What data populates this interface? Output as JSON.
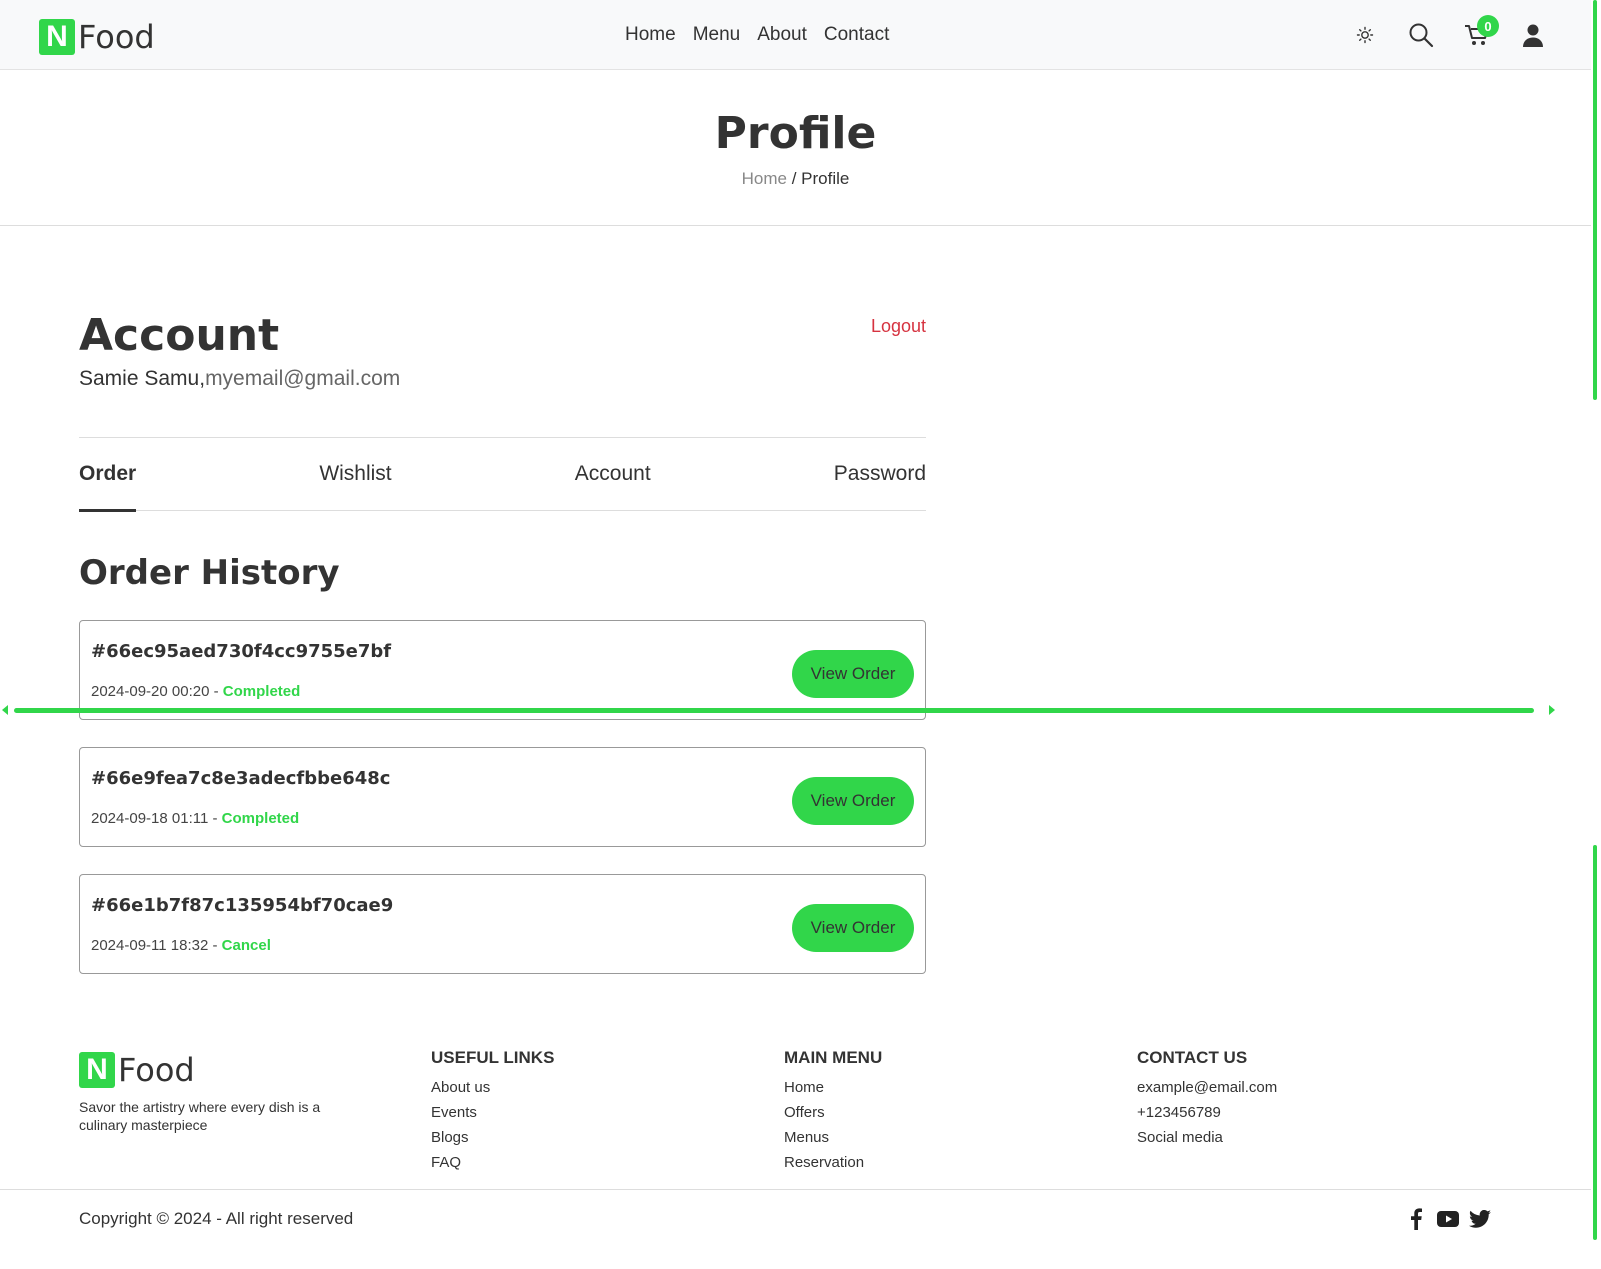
{
  "brand": {
    "logo_letter": "N",
    "name": "Food",
    "accent": "#31d64a"
  },
  "nav": {
    "links": [
      "Home",
      "Menu",
      "About",
      "Contact"
    ],
    "cart_count": "0",
    "icons": [
      "sun-icon",
      "search-icon",
      "cart-icon",
      "user-icon"
    ]
  },
  "page": {
    "title": "Profile",
    "breadcrumb_home": "Home",
    "breadcrumb_sep": " / ",
    "breadcrumb_current": "Profile"
  },
  "account": {
    "title": "Account",
    "logout": "Logout",
    "name": "Samie Samu,",
    "email": "myemail@gmail.com"
  },
  "tabs": [
    "Order",
    "Wishlist",
    "Account",
    "Password"
  ],
  "active_tab": "Order",
  "history": {
    "title": "Order History",
    "button_label": "View Order",
    "orders": [
      {
        "id": "#66ec95aed730f4cc9755e7bf",
        "datetime": "2024-09-20 00:20",
        "sep": " - ",
        "status": "Completed"
      },
      {
        "id": "#66e9fea7c8e3adecfbbe648c",
        "datetime": "2024-09-18 01:11",
        "sep": " - ",
        "status": "Completed"
      },
      {
        "id": "#66e1b7f87c135954bf70cae9",
        "datetime": "2024-09-11 18:32",
        "sep": " - ",
        "status": "Cancel"
      }
    ]
  },
  "footer": {
    "logo_letter": "N",
    "name": "Food",
    "description": "Savor the artistry where every dish is a culinary masterpiece",
    "useful_links": {
      "title": "USEFUL LINKS",
      "items": [
        "About us",
        "Events",
        "Blogs",
        "FAQ"
      ]
    },
    "main_menu": {
      "title": "MAIN MENU",
      "items": [
        "Home",
        "Offers",
        "Menus",
        "Reservation"
      ]
    },
    "contact": {
      "title": "CONTACT US",
      "items": [
        "example@email.com",
        "+123456789",
        "Social media"
      ]
    },
    "copyright": "Copyright © 2024 - All right reserved",
    "socials": [
      "facebook-icon",
      "youtube-icon",
      "twitter-icon"
    ]
  }
}
